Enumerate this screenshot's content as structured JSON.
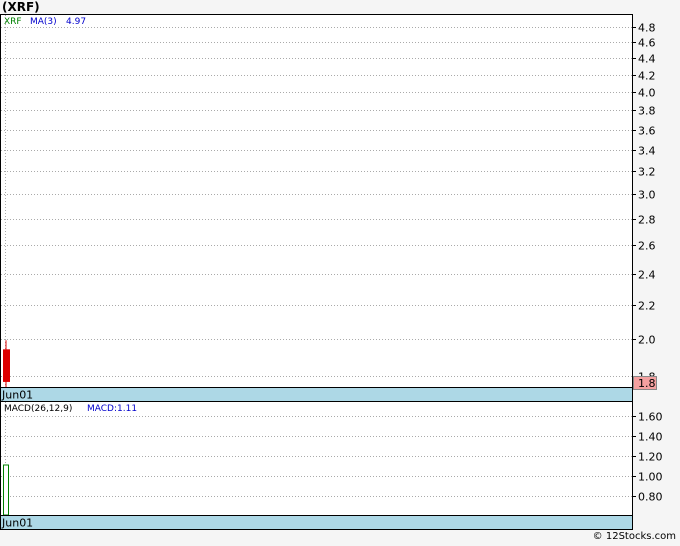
{
  "title": "(XRF)",
  "footer": "© 12Stocks.com",
  "chart_data": [
    {
      "type": "candlestick",
      "legend": {
        "ticker": "XRF",
        "ma_label": "MA(3)",
        "ma_value": "4.97"
      },
      "yticks": [
        "4.8",
        "4.6",
        "4.4",
        "4.2",
        "4.0",
        "3.8",
        "3.6",
        "3.4",
        "3.2",
        "3.0",
        "2.8",
        "2.6",
        "2.4",
        "2.2",
        "2.0",
        "1.8"
      ],
      "ylim": [
        1.74,
        4.97
      ],
      "candles": [
        {
          "date": "Jun01",
          "open": 1.94,
          "close": 1.77,
          "high": 1.99,
          "low": 1.73
        }
      ],
      "current_price_label": "1.8",
      "xlabels": [
        "Jun01"
      ],
      "colors": {
        "ticker": "#008000",
        "ma": "#0000cc",
        "candle": "#dd0000",
        "axis_band": "#add8e6",
        "price_box": "#f4a0a0"
      }
    },
    {
      "type": "bar",
      "legend": {
        "name": "MACD(26,12,9)",
        "macd_label": "MACD:1.11"
      },
      "yticks": [
        "1.60",
        "1.40",
        "1.20",
        "1.00",
        "0.80"
      ],
      "ylim": [
        0.6,
        1.74
      ],
      "bars": [
        {
          "date": "Jun01",
          "value": 1.11
        }
      ],
      "xlabels": [
        "Jun01"
      ],
      "colors": {
        "bar": "#008000",
        "macd_text": "#0000cc"
      }
    }
  ]
}
